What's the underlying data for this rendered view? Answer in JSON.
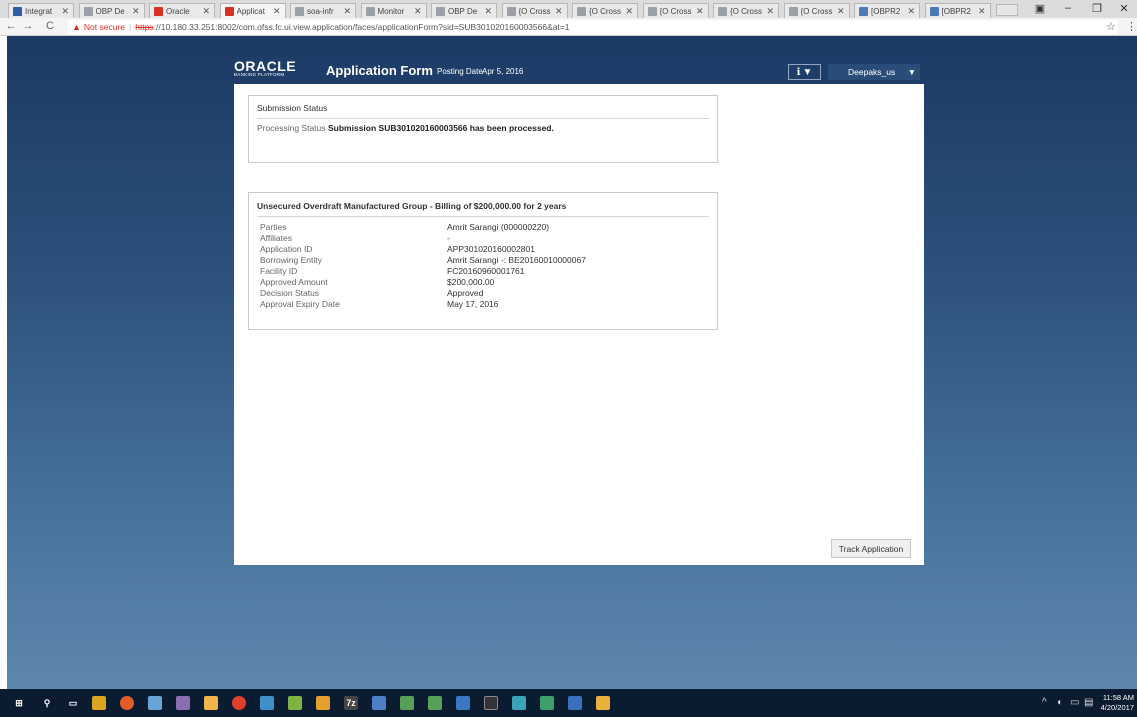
{
  "browser": {
    "tabs": [
      {
        "label": "Integrat",
        "icon": "arrow-icon",
        "color": "#2f5da8"
      },
      {
        "label": "OBP De",
        "icon": "page-icon",
        "color": "#9aa0a6"
      },
      {
        "label": "Oracle",
        "icon": "oracle-icon",
        "color": "#d93025"
      },
      {
        "label": "Applicat",
        "icon": "oracle-icon",
        "color": "#d93025",
        "active": true
      },
      {
        "label": "soa-infr",
        "icon": "page-icon",
        "color": "#9aa0a6"
      },
      {
        "label": "Monitor",
        "icon": "page-icon",
        "color": "#9aa0a6"
      },
      {
        "label": "OBP De",
        "icon": "page-icon",
        "color": "#9aa0a6"
      },
      {
        "label": "{O Cross R",
        "icon": "json-icon",
        "color": "#9aa0a6"
      },
      {
        "label": "{O Cross R",
        "icon": "json-icon",
        "color": "#9aa0a6"
      },
      {
        "label": "{O Cross R",
        "icon": "json-icon",
        "color": "#9aa0a6"
      },
      {
        "label": "{O Cross R",
        "icon": "json-icon",
        "color": "#9aa0a6"
      },
      {
        "label": "{O Cross R",
        "icon": "json-icon",
        "color": "#9aa0a6"
      },
      {
        "label": "[OBPR2",
        "icon": "award-icon",
        "color": "#4a7bb7"
      },
      {
        "label": "[OBPR2",
        "icon": "award-icon",
        "color": "#4a7bb7"
      }
    ],
    "not_secure": "Not secure",
    "url_scheme": "https",
    "url_rest": "://10.180.33.251:8002/com.ofss.fc.ui.view.application/faces/applicationForm?sid=SUB301020160003566&at=1"
  },
  "header": {
    "logo_word": "ORACLE",
    "logo_sub": "BANKING PLATFORM",
    "title": "Application Form",
    "posting_label": "Posting Date",
    "posting_date": "Apr 5, 2016",
    "user": "Deepaks_us"
  },
  "submission": {
    "title": "Submission Status",
    "label": "Processing Status",
    "message": "Submission SUB301020160003566 has been processed."
  },
  "facility": {
    "title": "Unsecured Overdraft Manufactured Group - Billing of $200,000.00 for 2 years",
    "rows": [
      {
        "label": "Parties",
        "value": "Amrit Sarangi (000000220)"
      },
      {
        "label": "Affiliates",
        "value": "-"
      },
      {
        "label": "Application ID",
        "value": "APP301020160002801"
      },
      {
        "label": "Borrowing Entity",
        "value": "Amrit Sarangi -: BE20160010000067"
      },
      {
        "label": "Facility ID",
        "value": "FC20160960001761"
      },
      {
        "label": "Approved Amount",
        "value": "$200,000.00"
      },
      {
        "label": "Decision Status",
        "value": "Approved"
      },
      {
        "label": "Approval Expiry Date",
        "value": "May 17, 2016"
      }
    ]
  },
  "actions": {
    "track_label": "Track Application"
  },
  "taskbar": {
    "time": "11:58 AM",
    "date": "4/20/2017"
  }
}
